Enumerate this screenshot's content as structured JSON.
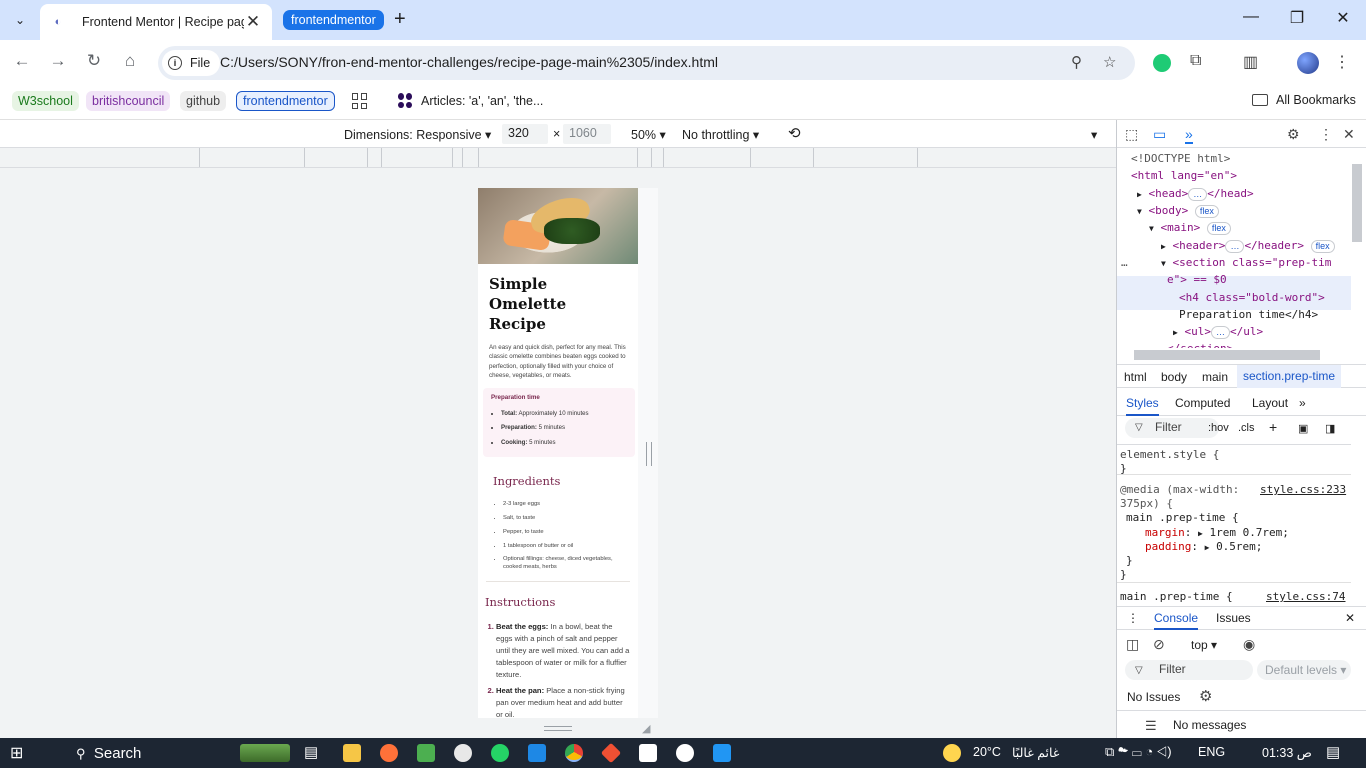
{
  "browser": {
    "tab_title": "Frontend Mentor | Recipe page",
    "tab_group": "frontendmentor",
    "new_tab": "+",
    "close": "✕",
    "url_chip": "File",
    "url": "C:/Users/SONY/fron-end-mentor-challenges/recipe-page-main%2305/index.html"
  },
  "bookmarks": {
    "items": [
      "W3school",
      "britishcouncil",
      "github",
      "frontendmentor"
    ],
    "article": "Articles: 'a', 'an', 'the...",
    "all": "All Bookmarks"
  },
  "device_toolbar": {
    "dimensions": "Dimensions: Responsive",
    "width": "320",
    "times": "×",
    "height": "1060",
    "zoom": "50%",
    "throttling": "No throttling"
  },
  "recipe": {
    "title": "Simple Omelette Recipe",
    "description": "An easy and quick dish, perfect for any meal. This classic omelette combines beaten eggs cooked to perfection, optionally filled with your choice of cheese, vegetables, or meats.",
    "prep": {
      "heading": "Preparation time",
      "items": [
        {
          "label": "Total:",
          "value": " Approximately 10 minutes"
        },
        {
          "label": "Preparation:",
          "value": " 5 minutes"
        },
        {
          "label": "Cooking:",
          "value": " 5 minutes"
        }
      ]
    },
    "ingredients": {
      "heading": "Ingredients",
      "items": [
        "2-3 large eggs",
        "Salt, to taste",
        "Pepper, to taste",
        "1 tablespoon of butter or oil",
        "Optional fillings: cheese, diced vegetables, cooked meats, herbs"
      ]
    },
    "instructions": {
      "heading": "Instructions",
      "items": [
        {
          "label": "Beat the eggs:",
          "value": " In a bowl, beat the eggs with a pinch of salt and pepper until they are well mixed. You can add a tablespoon of water or milk for a fluffier texture."
        },
        {
          "label": "Heat the pan:",
          "value": " Place a non-stick frying pan over medium heat and add butter or oil."
        }
      ]
    }
  },
  "devtools": {
    "elements": {
      "doctype": "<!DOCTYPE html>",
      "html_open": "<html lang=\"en\">",
      "head": "<head>",
      "head_close": "</head>",
      "body": "<body>",
      "main": "<main>",
      "header": "<header>",
      "header_close": "</header>",
      "section_a": "<section class=\"prep-tim",
      "section_b": "e\"> == $0",
      "h4": "<h4 class=\"bold-word\">",
      "h4_text": "Preparation time</h4>",
      "ul": "<ul>",
      "ul_close": "</ul>",
      "section_close": "</section>",
      "flex_badge": "flex",
      "ellipsis": "…"
    },
    "breadcrumbs": [
      "html",
      "body",
      "main",
      "section.prep-time"
    ],
    "style_tabs": [
      "Styles",
      "Computed",
      "Layout"
    ],
    "filter": "Filter",
    "hov": ":hov",
    "cls": ".cls",
    "styles": {
      "element_style": "element.style {",
      "close": "}",
      "media_a": "@media (max-width:",
      "media_b": "375px) {",
      "source1": "style.css:233",
      "selector": "main .prep-time {",
      "margin_prop": "margin",
      "margin_val": "1rem 0.7rem;",
      "padding_prop": "padding",
      "padding_val": "0.5rem;",
      "selector2": "main .prep-time {",
      "source2": "style.css:74"
    },
    "drawer_tabs": [
      "Console",
      "Issues"
    ],
    "console": {
      "top": "top",
      "filter": "Filter",
      "levels": "Default levels",
      "no_issues": "No Issues",
      "no_messages": "No messages"
    }
  },
  "taskbar": {
    "search": "Search",
    "weather_temp": "20°C",
    "weather_text": "غائم غالبًا",
    "lang": "ENG",
    "time": "01:33 ص"
  },
  "colors": {
    "accent": "#1a73e8",
    "recipe_accent": "#7a284e",
    "prep_bg": "#fcf2f7"
  }
}
